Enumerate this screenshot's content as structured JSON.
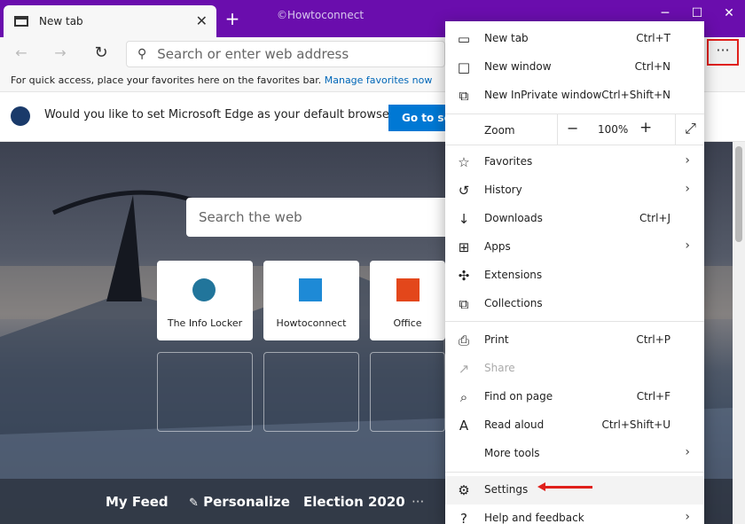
{
  "tab": {
    "title": "New tab",
    "close": "✕"
  },
  "new_tab_symbol": "+",
  "watermark": "©Howtoconnect",
  "window_controls": {
    "minimize": "─",
    "maximize": "☐",
    "close": "✕"
  },
  "address": {
    "placeholder": "Search or enter web address"
  },
  "menu_button": "···",
  "favorites_bar": {
    "text": "For quick access, place your favorites here on the favorites bar.",
    "link": "Manage favorites now"
  },
  "default_bar": {
    "text": "Would you like to set Microsoft Edge as your default browser?",
    "button": "Go to set",
    "close": "✕"
  },
  "newtab": {
    "search_placeholder": "Search the web",
    "tiles": [
      {
        "label": "The Info Locker",
        "icon": "wordpress-icon"
      },
      {
        "label": "Howtoconnect",
        "icon": "howtoconnect-icon"
      },
      {
        "label": "Office",
        "icon": "office-icon"
      }
    ],
    "feed": [
      "My Feed",
      "Personalize",
      "Election 2020"
    ],
    "feed_more": "···"
  },
  "menu": {
    "items_top": [
      {
        "label": "New tab",
        "shortcut": "Ctrl+T",
        "icon": "new-tab-icon"
      },
      {
        "label": "New window",
        "shortcut": "Ctrl+N",
        "icon": "new-window-icon"
      },
      {
        "label": "New InPrivate window",
        "shortcut": "Ctrl+Shift+N",
        "icon": "inprivate-icon"
      }
    ],
    "zoom": {
      "label": "Zoom",
      "minus": "−",
      "value": "100%",
      "plus": "+",
      "fullscreen": "⤢"
    },
    "items_mid": [
      {
        "label": "Favorites",
        "shortcut": "",
        "arrow": "›",
        "icon": "favorites-icon"
      },
      {
        "label": "History",
        "shortcut": "",
        "arrow": "›",
        "icon": "history-icon"
      },
      {
        "label": "Downloads",
        "shortcut": "Ctrl+J",
        "arrow": "",
        "icon": "downloads-icon"
      },
      {
        "label": "Apps",
        "shortcut": "",
        "arrow": "›",
        "icon": "apps-icon"
      },
      {
        "label": "Extensions",
        "shortcut": "",
        "arrow": "",
        "icon": "extensions-icon"
      },
      {
        "label": "Collections",
        "shortcut": "",
        "arrow": "",
        "icon": "collections-icon"
      }
    ],
    "items_low": [
      {
        "label": "Print",
        "shortcut": "Ctrl+P",
        "arrow": "",
        "icon": "print-icon"
      },
      {
        "label": "Share",
        "shortcut": "",
        "arrow": "",
        "icon": "share-icon",
        "disabled": true
      },
      {
        "label": "Find on page",
        "shortcut": "Ctrl+F",
        "arrow": "",
        "icon": "find-icon"
      },
      {
        "label": "Read aloud",
        "shortcut": "Ctrl+Shift+U",
        "arrow": "",
        "icon": "read-aloud-icon"
      },
      {
        "label": "More tools",
        "shortcut": "",
        "arrow": "›",
        "icon": ""
      }
    ],
    "items_bottom": [
      {
        "label": "Settings",
        "shortcut": "",
        "arrow": "",
        "icon": "settings-icon"
      },
      {
        "label": "Help and feedback",
        "shortcut": "",
        "arrow": "›",
        "icon": "help-icon"
      }
    ]
  },
  "colors": {
    "titlebar": "#6a0dad",
    "accent": "#0078d4",
    "highlight": "#e0201b"
  }
}
